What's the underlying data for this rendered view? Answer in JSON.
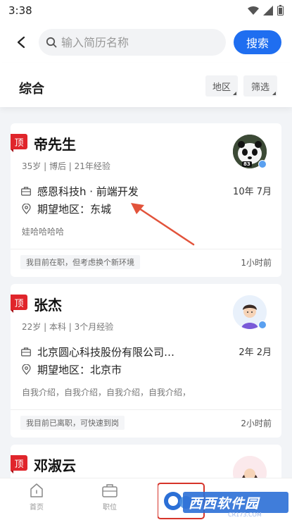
{
  "status_bar": {
    "time": "3:38"
  },
  "search": {
    "placeholder": "输入简历名称",
    "button_label": "搜索"
  },
  "filter": {
    "title": "综合",
    "region_label": "地区",
    "filter_label": "筛选"
  },
  "cards": [
    {
      "badge": "顶",
      "name": "帝先生",
      "meta": "35岁 | 博后 | 21年经验",
      "job": "感恩科技h · 前端开发",
      "date": "10年 7月",
      "region": "期望地区：东城",
      "intro": "娃哈哈哈哈",
      "status": "我目前在职，但考虑换个新环境",
      "time_ago": "1小时前",
      "avatar_label": "83"
    },
    {
      "badge": "顶",
      "name": "张杰",
      "meta": "22岁 | 本科 | 3个月经验",
      "job": "北京圆心科技股份有限公司…",
      "date": "2年 2月",
      "region": "期望地区：北京市",
      "intro": "自我介绍，自我介绍，自我介绍，自我介绍，",
      "status": "我目前已离职，可快速到岗",
      "time_ago": "2小时前"
    },
    {
      "badge": "顶",
      "name": "邓淑云"
    }
  ],
  "tabbar": {
    "home": "首页",
    "jobs": "职位"
  },
  "watermark": {
    "text": "西西软件园",
    "domain": "CR173.COM"
  },
  "colors": {
    "accent": "#1f6ef0",
    "badge": "#e0252b",
    "arrow": "#e2533b"
  }
}
